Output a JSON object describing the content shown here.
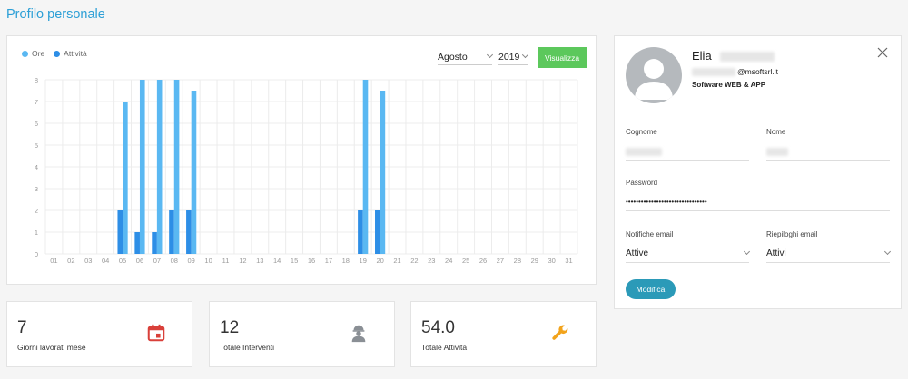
{
  "page": {
    "title": "Profilo personale"
  },
  "colors": {
    "ore": "#5ab8f2",
    "attivita": "#2d8ee6",
    "primary": "#2c9fd6",
    "success": "#5cc85c"
  },
  "filters": {
    "month": "Agosto",
    "year": "2019",
    "button_label": "Visualizza"
  },
  "chart_data": {
    "type": "bar",
    "categories": [
      "01",
      "02",
      "03",
      "04",
      "05",
      "06",
      "07",
      "08",
      "09",
      "10",
      "11",
      "12",
      "13",
      "14",
      "15",
      "16",
      "17",
      "18",
      "19",
      "20",
      "21",
      "22",
      "23",
      "24",
      "25",
      "26",
      "27",
      "28",
      "29",
      "30",
      "31"
    ],
    "series": [
      {
        "name": "Ore",
        "values": [
          0,
          0,
          0,
          0,
          7,
          8,
          8,
          8,
          7.5,
          0,
          0,
          0,
          0,
          0,
          0,
          0,
          0,
          0,
          8,
          7.5,
          0,
          0,
          0,
          0,
          0,
          0,
          0,
          0,
          0,
          0,
          0
        ]
      },
      {
        "name": "Attività",
        "values": [
          0,
          0,
          0,
          0,
          2,
          1,
          1,
          2,
          2,
          0,
          0,
          0,
          0,
          0,
          0,
          0,
          0,
          0,
          2,
          2,
          0,
          0,
          0,
          0,
          0,
          0,
          0,
          0,
          0,
          0,
          0
        ]
      }
    ],
    "ylim": [
      0,
      8
    ],
    "yticks": [
      "0",
      "1",
      "2",
      "3",
      "4",
      "5",
      "6",
      "7",
      "8"
    ],
    "grid": true,
    "legend": "top-left"
  },
  "stats": [
    {
      "value": "7",
      "label": "Giorni lavorati mese",
      "icon": "calendar-icon",
      "color": "#d9403a"
    },
    {
      "value": "12",
      "label": "Totale Interventi",
      "icon": "worker-icon",
      "color": "#8a8f95"
    },
    {
      "value": "54.0",
      "label": "Totale Attività",
      "icon": "wrench-icon",
      "color": "#f2a31b"
    }
  ],
  "profile": {
    "first_name": "Elia",
    "email_domain": "@msoftsrl.it",
    "company": "Software WEB & APP",
    "fields": {
      "cognome_label": "Cognome",
      "nome_label": "Nome",
      "password_label": "Password",
      "password_value": "••••••••••••••••••••••••••••••••",
      "notifiche_label": "Notifiche email",
      "notifiche_value": "Attive",
      "riepiloghi_label": "Riepiloghi email",
      "riepiloghi_value": "Attivi"
    },
    "edit_button": "Modifica"
  }
}
